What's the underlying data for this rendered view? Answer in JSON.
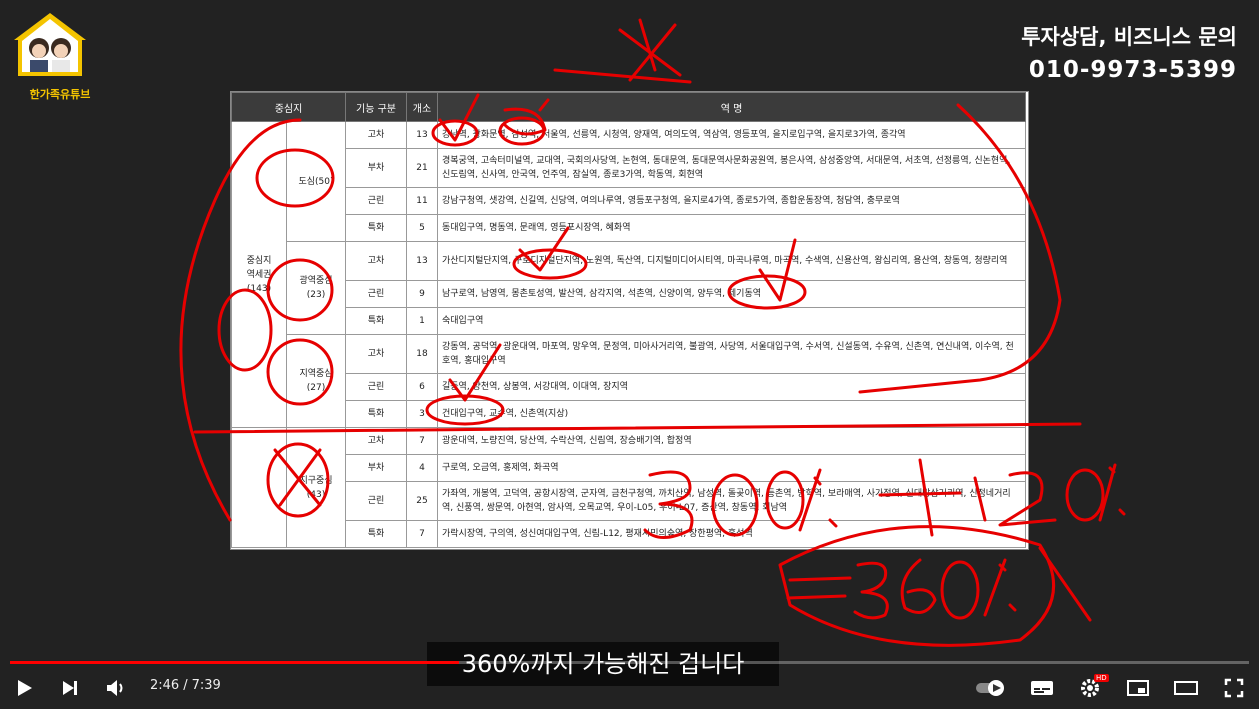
{
  "channel": {
    "logo_text": "한가족유튜브"
  },
  "contact": {
    "line1": "투자상담, 비즈니스 문의",
    "line2": "010-9973-5399"
  },
  "table": {
    "headers": [
      "중심지",
      "기능 구분",
      "개소",
      "역 명"
    ],
    "groups": [
      {
        "name": "중심지\n역세권\n(143)",
        "sub": [
          {
            "name": "도심(50)",
            "rows": [
              {
                "type": "고차",
                "count": "13",
                "stations": "강남역, 광화문역, 삼성역, 서울역, 선릉역, 시청역, 양재역, 여의도역, 역삼역, 영등포역, 을지로입구역, 을지로3가역, 종각역"
              },
              {
                "type": "부차",
                "count": "21",
                "stations": "경복궁역, 고속터미널역, 교대역, 국회의사당역, 논현역, 동대문역, 동대문역사문화공원역, 봉은사역, 삼성중앙역, 서대문역, 서초역, 선정릉역, 신논현역, 신도림역, 신사역, 안국역, 언주역, 잠실역, 종로3가역, 학동역, 회현역"
              },
              {
                "type": "근린",
                "count": "11",
                "stations": "강남구청역, 샛강역, 신길역, 신당역, 여의나루역, 영등포구청역, 을지로4가역, 종로5가역, 종합운동장역, 청담역, 충무로역"
              },
              {
                "type": "특화",
                "count": "5",
                "stations": "동대입구역, 명동역, 문래역, 영등포시장역, 혜화역"
              }
            ]
          },
          {
            "name": "광역중심\n(23)",
            "rows": [
              {
                "type": "고차",
                "count": "13",
                "stations": "가산디지털단지역, 구로디지털단지역, 노원역, 독산역, 디지털미디어시티역, 마곡나루역, 마곡역, 수색역, 신용산역, 왕십리역, 용산역, 창동역, 청량리역"
              },
              {
                "type": "근린",
                "count": "9",
                "stations": "남구로역, 남영역, 몽촌토성역, 발산역, 삼각지역, 석촌역, 신양이역, 양두역, 제기동역"
              },
              {
                "type": "특화",
                "count": "1",
                "stations": "숙대입구역"
              }
            ]
          },
          {
            "name": "지역중심\n(27)",
            "rows": [
              {
                "type": "고차",
                "count": "18",
                "stations": "강동역, 공덕역, 광운대역, 마포역, 망우역, 문정역, 미아사거리역, 불광역, 사당역, 서울대입구역, 수서역, 신설동역, 수유역, 신촌역, 연신내역, 이수역, 천호역, 홍대입구역"
              },
              {
                "type": "근린",
                "count": "6",
                "stations": "길동역, 양천역, 상봉역, 서강대역, 이대역, 장지역"
              },
              {
                "type": "특화",
                "count": "3",
                "stations": "건대입구역, 교수역, 신촌역(지상)"
              }
            ]
          }
        ]
      },
      {
        "name": "",
        "sub": [
          {
            "name": "지구중심\n(43)",
            "rows": [
              {
                "type": "고차",
                "count": "7",
                "stations": "광운대역, 노량진역, 당산역, 수락산역, 신림역, 장승배기역, 합정역"
              },
              {
                "type": "부차",
                "count": "4",
                "stations": "구로역, 오금역, 홍제역, 화곡역"
              },
              {
                "type": "근린",
                "count": "25",
                "stations": "가좌역, 개봉역, 고덕역, 공항시장역, 군자역, 금천구청역, 까치산역, 남성역, 돌곶이역, 등촌역, 방학역, 보라매역, 사가정역, 신대방삼거리역, 신정네거리역, 신풍역, 쌍문역, 아현역, 암사역, 오목교역, 우이-L05, 우이-L07, 증산역, 창동역, 회남역"
              },
              {
                "type": "특화",
                "count": "7",
                "stations": "가락시장역, 구의역, 성신여대입구역, 신림-L12, 평재시민의숲역, 장한평역, 혹석역"
              }
            ]
          }
        ]
      }
    ]
  },
  "handwriting": {
    "line1": "300% + 120%.",
    "line2": "= 360%"
  },
  "caption": "360%까지 가능해진 겁니다",
  "player": {
    "current_time": "2:46",
    "separator": "/",
    "duration": "7:39",
    "progress": 0.362,
    "accent": "#ff0000",
    "hd_badge": "HD"
  }
}
